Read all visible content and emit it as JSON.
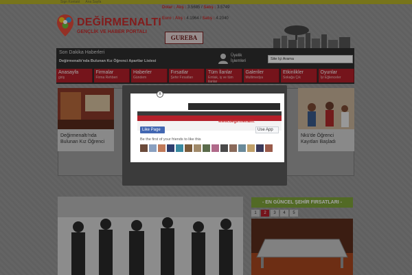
{
  "toplinks": [
    "Sign Kontakt",
    "Ana Sayfa"
  ],
  "logo": {
    "title": "DEĞİRMENALTI",
    "subtitle": "GENÇLİK VE HABER PORTALI"
  },
  "currency": {
    "dolar_label": "Dolar :",
    "alis_label": "Alış :",
    "satis_label": "Satış :",
    "dolar_alis": "3.5685",
    "dolar_satis": "3.5749",
    "euro_label": "Euro :",
    "euro_alis": "4.1964",
    "euro_satis": "4.2040"
  },
  "sponsor": "GUREBA",
  "news": {
    "heading": "Son Dakika Haberleri",
    "headline": "Değirmenaltı'nda Bulunan Kız Öğrenci Apartlar Listesi"
  },
  "user": {
    "line1": "Üyelik",
    "line2": "İşlemleri"
  },
  "search": {
    "value": "Site İçi Arama"
  },
  "nav": [
    {
      "title": "Anasayfa",
      "sub": "giriş"
    },
    {
      "title": "Firmalar",
      "sub": "Firma Rehberi"
    },
    {
      "title": "Haberler",
      "sub": "Gündem"
    },
    {
      "title": "Fırsatlar",
      "sub": "Şehir Fırsatları"
    },
    {
      "title": "Tüm İlanlar",
      "sub": "Emlak, iş ve tüm ilanlar"
    },
    {
      "title": "Galeriler",
      "sub": "Multimedya"
    },
    {
      "title": "Etkinlikler",
      "sub": "Sokağa Çık"
    },
    {
      "title": "Oyunlar",
      "sub": "İyi Eğlenceler"
    }
  ],
  "cards": [
    {
      "caption": "Değirmenaltı'nda Bulunan Kız Öğrenci"
    },
    {
      "caption": "Nkü'de Öğrenci Kayıtları Başladı"
    }
  ],
  "modal": {
    "like_label": "Like Page",
    "use_app_label": "Use App",
    "url_text": "www.degirmenalti.",
    "friends_text": "Be the first of your friends to like this",
    "close_label": "x"
  },
  "deals": {
    "heading": "- EN GÜNCEL ŞEHİR FIRSATLARI -",
    "pages": [
      "1",
      "2",
      "3",
      "4",
      "5"
    ],
    "active_page": "2"
  },
  "colors": {
    "brand_red": "#b4202a",
    "deals_green": "#7ea33a",
    "header_dark": "#2f2f2f",
    "facebook_blue": "#4267b2"
  }
}
